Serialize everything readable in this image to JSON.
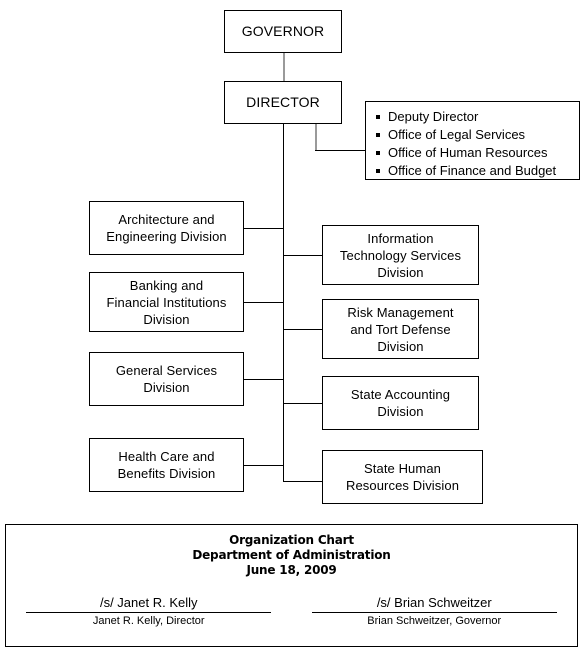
{
  "chart_data": {
    "type": "diagram",
    "title": "Organization Chart",
    "subtitle": "Department of Administration",
    "date": "June 18, 2009",
    "nodes": [
      {
        "id": "governor",
        "label": "GOVERNOR",
        "level": 0
      },
      {
        "id": "director",
        "label": "DIRECTOR",
        "level": 1
      },
      {
        "id": "staff",
        "label": "Deputy Director; Office of Legal Services; Office of Human Resources; Office of Finance and Budget",
        "level": 2
      },
      {
        "id": "arch",
        "label": "Architecture and Engineering Division",
        "level": 2
      },
      {
        "id": "bank",
        "label": "Banking and Financial Institutions Division",
        "level": 2
      },
      {
        "id": "gensvc",
        "label": "General Services Division",
        "level": 2
      },
      {
        "id": "health",
        "label": "Health Care and Benefits Division",
        "level": 2
      },
      {
        "id": "its",
        "label": "Information Technology Services Division",
        "level": 2
      },
      {
        "id": "risk",
        "label": "Risk Management and Tort Defense Division",
        "level": 2
      },
      {
        "id": "acct",
        "label": "State Accounting Division",
        "level": 2
      },
      {
        "id": "shr",
        "label": "State Human Resources Division",
        "level": 2
      }
    ],
    "edges": [
      {
        "from": "governor",
        "to": "director"
      },
      {
        "from": "director",
        "to": "staff"
      },
      {
        "from": "director",
        "to": "arch"
      },
      {
        "from": "director",
        "to": "bank"
      },
      {
        "from": "director",
        "to": "gensvc"
      },
      {
        "from": "director",
        "to": "health"
      },
      {
        "from": "director",
        "to": "its"
      },
      {
        "from": "director",
        "to": "risk"
      },
      {
        "from": "director",
        "to": "acct"
      },
      {
        "from": "director",
        "to": "shr"
      }
    ]
  },
  "top": {
    "governor": "GOVERNOR",
    "director": "DIRECTOR"
  },
  "staff_office": {
    "items": [
      "Deputy Director",
      "Office of Legal Services",
      "Office of Human Resources",
      "Office of Finance and Budget"
    ]
  },
  "left_divisions": [
    "Architecture and\nEngineering Division",
    "Banking and\nFinancial Institutions\nDivision",
    "General Services\nDivision",
    "Health Care and\nBenefits Division"
  ],
  "right_divisions": [
    "Information\nTechnology Services\nDivision",
    "Risk Management\nand Tort Defense\nDivision",
    "State Accounting\nDivision",
    "State Human\nResources Division"
  ],
  "footer": {
    "title_line1": "Organization Chart",
    "title_line2": "Department of Administration",
    "title_line3": "June 18, 2009",
    "signatures": [
      {
        "signature": "/s/ Janet R. Kelly",
        "name_title": "Janet R. Kelly, Director"
      },
      {
        "signature": "/s/ Brian Schweitzer",
        "name_title": "Brian Schweitzer, Governor"
      }
    ]
  },
  "colors": {
    "border": "#000000",
    "background": "#ffffff",
    "text": "#000000",
    "connector_gray": "#9a9a9a"
  }
}
